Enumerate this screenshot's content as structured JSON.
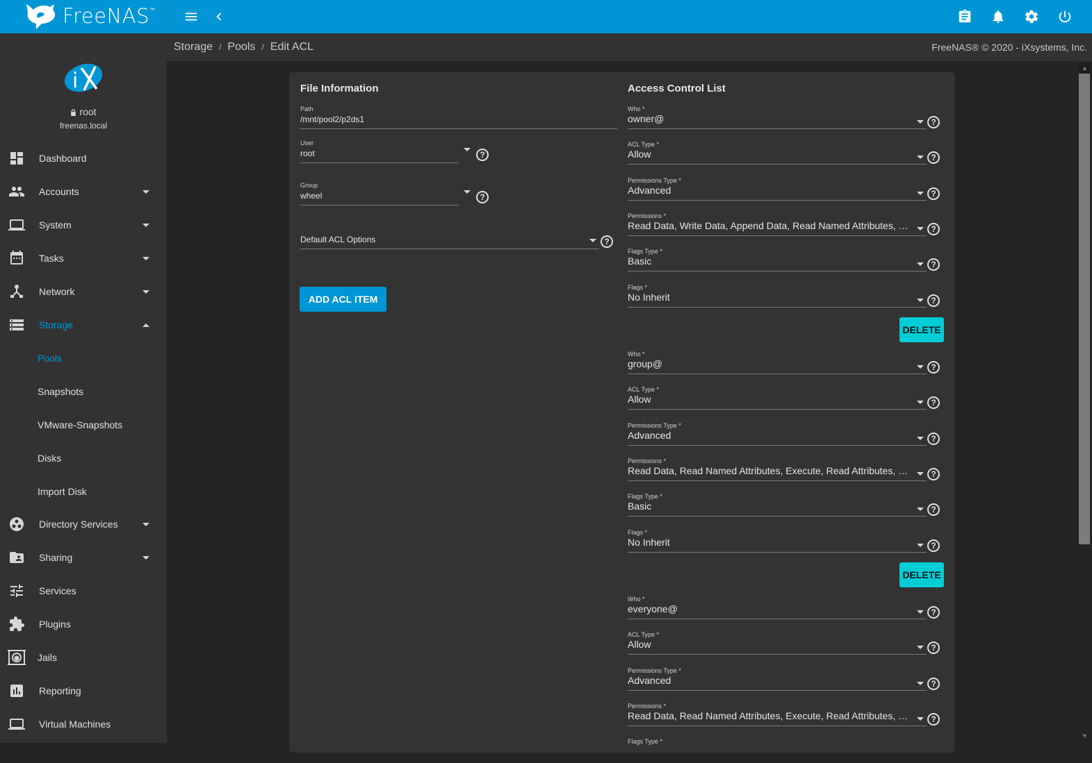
{
  "app": {
    "brand": "FreeNAS",
    "trademark": "™",
    "copyright": "FreeNAS® © 2020 - iXsystems, Inc.",
    "accent_color": "#0095d5",
    "delete_color": "#00cdd6"
  },
  "topbar": {
    "icons": [
      "menu-icon",
      "back-chevron-icon",
      "clipboard-icon",
      "bell-icon",
      "gear-icon",
      "power-icon"
    ]
  },
  "breadcrumb": [
    {
      "label": "Storage"
    },
    {
      "label": "Pools"
    },
    {
      "label": "Edit ACL"
    }
  ],
  "breadcrumb_sep": "/",
  "user": {
    "name": "root",
    "host": "freenas.local"
  },
  "sidebar": {
    "items": [
      {
        "label": "Dashboard",
        "icon": "dashboard-icon"
      },
      {
        "label": "Accounts",
        "icon": "people-icon",
        "expandable": true
      },
      {
        "label": "System",
        "icon": "laptop-icon",
        "expandable": true
      },
      {
        "label": "Tasks",
        "icon": "calendar-icon",
        "expandable": true
      },
      {
        "label": "Network",
        "icon": "network-icon",
        "expandable": true
      },
      {
        "label": "Storage",
        "icon": "storage-icon",
        "expandable": true,
        "expanded": true,
        "active": true
      },
      {
        "label": "Directory Services",
        "icon": "directory-icon",
        "expandable": true
      },
      {
        "label": "Sharing",
        "icon": "folder-shared-icon",
        "expandable": true
      },
      {
        "label": "Services",
        "icon": "tune-icon"
      },
      {
        "label": "Plugins",
        "icon": "puzzle-icon"
      },
      {
        "label": "Jails",
        "icon": "jail-icon"
      },
      {
        "label": "Reporting",
        "icon": "chart-icon"
      },
      {
        "label": "Virtual Machines",
        "icon": "computer-icon"
      }
    ],
    "storage_sub": [
      {
        "label": "Pools",
        "active": true
      },
      {
        "label": "Snapshots"
      },
      {
        "label": "VMware-Snapshots"
      },
      {
        "label": "Disks"
      },
      {
        "label": "Import Disk"
      }
    ]
  },
  "file_info": {
    "title": "File Information",
    "path": {
      "label": "Path",
      "value": "/mnt/pool2/p2ds1"
    },
    "user": {
      "label": "User",
      "value": "root"
    },
    "group": {
      "label": "Group",
      "value": "wheel"
    },
    "default_acl": {
      "label": "Default ACL Options",
      "value": ""
    },
    "add_button": "ADD ACL ITEM"
  },
  "acl": {
    "title": "Access Control List",
    "labels": {
      "who": "Who *",
      "acl_type": "ACL Type *",
      "perm_type": "Permissions Type *",
      "perms": "Permissions *",
      "flags_type": "Flags Type *",
      "flags": "Flags *"
    },
    "delete_label": "DELETE",
    "items": [
      {
        "who": "owner@",
        "acl_type": "Allow",
        "perm_type": "Advanced",
        "perms": "Read Data, Write Data, Append Data, Read Named Attributes, Wri...",
        "flags_type": "Basic",
        "flags": "No Inherit"
      },
      {
        "who": "group@",
        "acl_type": "Allow",
        "perm_type": "Advanced",
        "perms": "Read Data, Read Named Attributes, Execute, Read Attributes, Rea...",
        "flags_type": "Basic",
        "flags": "No Inherit"
      },
      {
        "who": "everyone@",
        "acl_type": "Allow",
        "perm_type": "Advanced",
        "perms": "Read Data, Read Named Attributes, Execute, Read Attributes, Rea...",
        "flags_type": "",
        "flags": ""
      }
    ]
  }
}
